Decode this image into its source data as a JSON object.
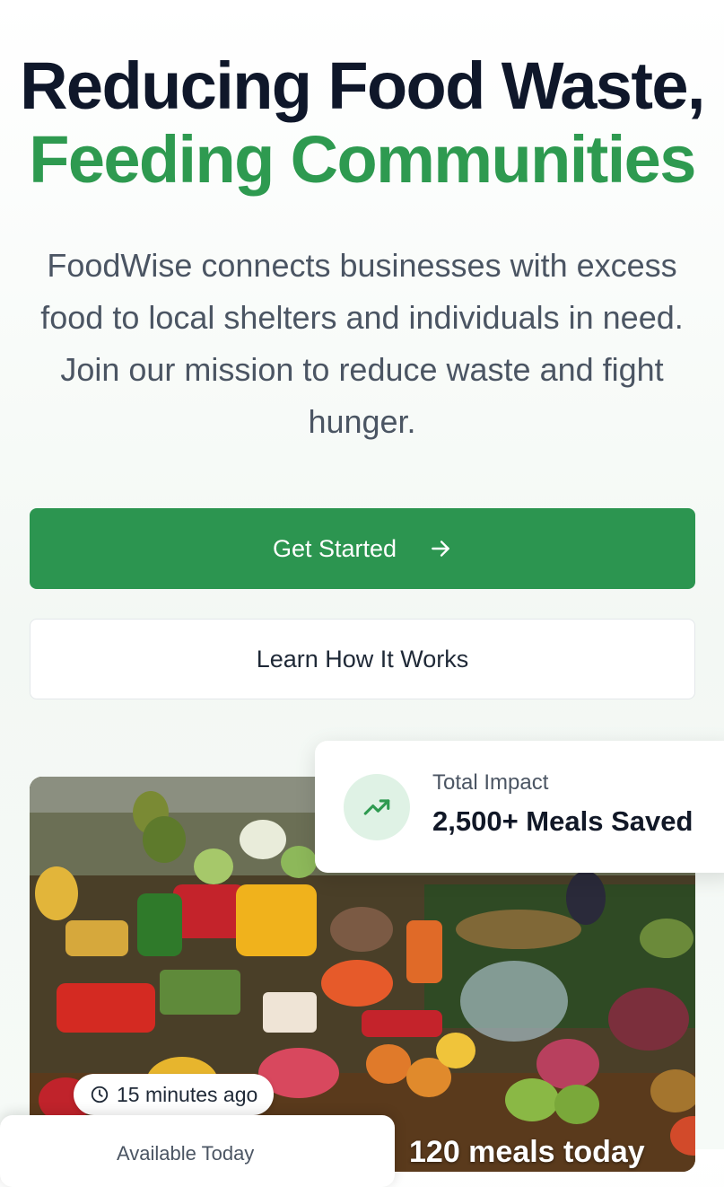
{
  "hero": {
    "title_line1": "Reducing Food Waste,",
    "title_line2": "Feeding Communities",
    "description": "FoodWise connects businesses with excess food to local shelters and individuals in need. Join our mission to reduce waste and fight hunger."
  },
  "actions": {
    "primary_label": "Get Started",
    "primary_icon": "arrow-right-icon",
    "secondary_label": "Learn How It Works"
  },
  "impact": {
    "label": "Total Impact",
    "value": "2,500+ Meals Saved",
    "icon": "trending-up-icon"
  },
  "photo": {
    "time_badge": "15 minutes ago",
    "clock_icon": "clock-icon",
    "bottom_card_peek": "Available Today",
    "meals_today": "120 meals today"
  },
  "colors": {
    "accent": "#2e9a50",
    "primary_button": "#2c9550",
    "heading": "#0f172a",
    "body_text": "#4b5563"
  }
}
